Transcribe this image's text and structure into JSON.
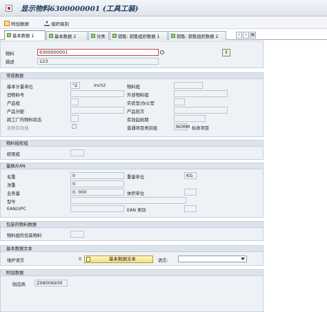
{
  "window": {
    "title": "显示物料6300000001 (工具工装)"
  },
  "toolbar": {
    "add_data_label": "附加数据",
    "org_levels_label": "组织级别"
  },
  "tabs": [
    {
      "label": "基本数据 1"
    },
    {
      "label": "基本数据 2"
    },
    {
      "label": "分类"
    },
    {
      "label": "销售: 销售组织数据 1"
    },
    {
      "label": "销售: 销售组织数据 2"
    }
  ],
  "header": {
    "material_label": "物料",
    "material_value": "6300000001",
    "description_label": "描述",
    "description_value": "123"
  },
  "general": {
    "title": "常规数据",
    "base_uom_label": "基本计量单位",
    "base_uom_value": "\"2",
    "base_uom_text": "Inch2",
    "old_material_label": "旧物料号",
    "product_group_label": "产品组",
    "product_alloc_label": "产品分配",
    "cross_plant_status_label": "跨工厂的物料状态",
    "ref_valid_label": "参数有效值",
    "material_group_label": "物料组",
    "ext_material_group_label": "外部物料组",
    "lab_office_label": "实验室/办公室",
    "product_hierarchy_label": "产品层次",
    "valid_from_label": "有效起始期",
    "item_cat_group_label": "普通项目类别组",
    "item_cat_group_value": "NORM",
    "item_cat_group_text": "标准项目"
  },
  "authorization": {
    "title": "物料授权组",
    "auth_group_label": "权限组"
  },
  "dimensions": {
    "title": "量纲/EAN",
    "gross_weight_label": "毛重",
    "gross_weight_value": "0",
    "weight_unit_label": "重量单位",
    "weight_unit_value": "KG",
    "net_weight_label": "净重",
    "net_weight_value": "0",
    "volume_label": "业务量",
    "volume_value": "0. 000",
    "volume_unit_label": "体积单位",
    "size_label": "型号",
    "ean_label": "EAN/UPC",
    "ean_category_label": "EAN 类别"
  },
  "packaging": {
    "title": "包装的物料数据",
    "pack_group_label": "物料组的包装物料"
  },
  "basic_text": {
    "title": "基本数据文本",
    "maint_lang_label": "维护语言",
    "maint_lang_value": "0",
    "button_label": "基本数据文本",
    "language_label": "语言:"
  },
  "additional": {
    "title": "附加数据",
    "manufacturer_label": "制造商",
    "manufacturer_value": "Z08006930"
  },
  "icons": {
    "window": "sap-window-icon",
    "add_data": "add-data-icon",
    "org_levels": "org-levels-icon",
    "info": "info-icon",
    "text": "text-editor-icon"
  }
}
